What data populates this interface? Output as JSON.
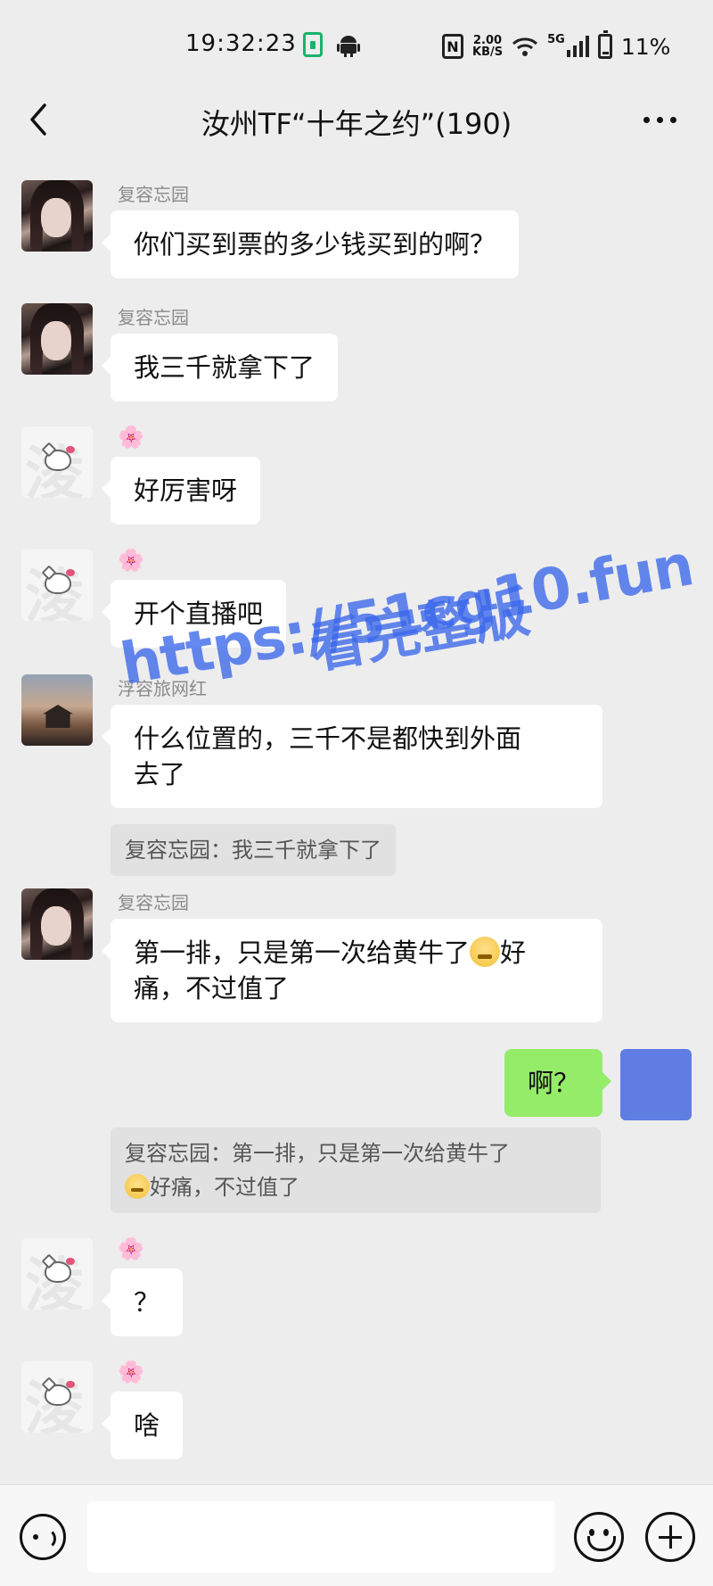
{
  "status_bar": {
    "time": "19:32:23",
    "net_speed_value": "2.00",
    "net_speed_unit": "KB/S",
    "network": "5G",
    "battery": "11%"
  },
  "header": {
    "title": "汝州TF“十年之约”(190)"
  },
  "messages": [
    {
      "sender": "复容忘园",
      "avatar": "girl",
      "text": "你们买到票的多少钱买到的啊？"
    },
    {
      "sender": "复容忘园",
      "avatar": "girl",
      "text": "我三千就拿下了"
    },
    {
      "sender": "🌸",
      "avatar": "kitty",
      "text": "好厉害呀"
    },
    {
      "sender": "🌸",
      "avatar": "kitty",
      "text": "开个直播吧"
    },
    {
      "sender": "浮容旅网红",
      "avatar": "sunset",
      "text_line1": "什么位置的，三千不是都快到外面",
      "text_line2": "去了",
      "quote": "复容忘园：我三千就拿下了"
    },
    {
      "sender": "复容忘园",
      "avatar": "girl",
      "text_line1a": "第一排，只是第一次给黄牛了",
      "text_line1b": "好",
      "text_line2": "痛，不过值了"
    },
    {
      "sender": "self",
      "avatar": "self",
      "text": "啊？",
      "quote_line1": "复容忘园：第一排，只是第一次给黄牛了",
      "quote_line2": "好痛，不过值了"
    },
    {
      "sender": "🌸",
      "avatar": "kitty",
      "text": "？"
    },
    {
      "sender": "🌸",
      "avatar": "kitty",
      "text": "啥"
    }
  ],
  "watermark": {
    "url": "https://51cg10.fun",
    "caption": "看完整版"
  },
  "avatar_glyph": "淩",
  "colors": {
    "background": "#ededed",
    "self_bubble": "#95ec69",
    "self_avatar": "#5f7de3",
    "watermark": "#3a66eb"
  },
  "icons": [
    "back-icon",
    "more-icon",
    "voice-icon",
    "emoji-icon",
    "plus-icon",
    "cherry-blossom-icon"
  ]
}
